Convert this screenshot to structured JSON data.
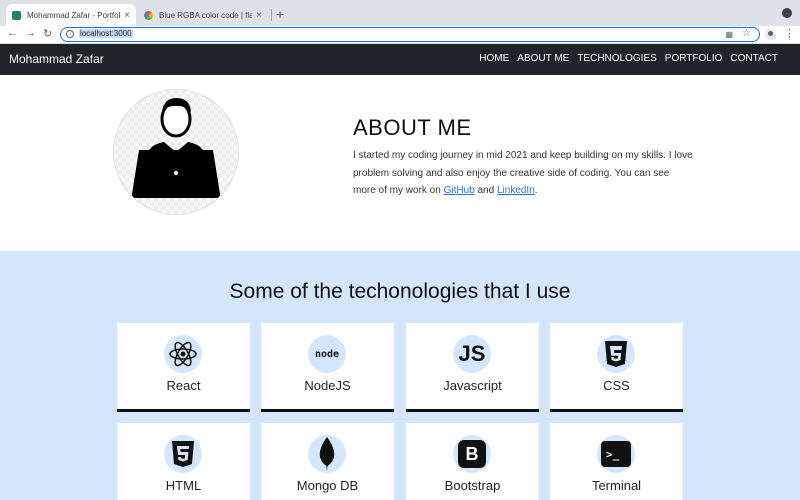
{
  "browser": {
    "tabs": [
      {
        "title": "Mohammad Zafar - Portfolio",
        "favicon_color": "#2e7d6e"
      },
      {
        "title": "Blue RGBA color code | flatuic",
        "favicon_color": "#f4b400"
      }
    ],
    "new_tab": "+",
    "close": "×",
    "address": "localhost:3000",
    "back": "←",
    "forward": "→",
    "reload": "↻",
    "star": "☆",
    "menu": "⋮"
  },
  "site": {
    "brand": "Mohammad Zafar",
    "menu": [
      "HOME",
      "ABOUT ME",
      "TECHNOLOGIES",
      "PORTFOLIO",
      "CONTACT"
    ]
  },
  "about": {
    "title": "ABOUT ME",
    "text_before": "I started my coding journey in mid 2021 and keep building on my skills. I love problem solving and also enjoy the creative side of coding. You can see more of my work on ",
    "link1": "GitHub",
    "middle": " and ",
    "link2": "LinkedIn",
    "end": "."
  },
  "tech": {
    "title": "Some of the techonologies that I use",
    "items": [
      {
        "label": "React",
        "icon": "react-icon"
      },
      {
        "label": "NodeJS",
        "icon": "nodejs-icon"
      },
      {
        "label": "Javascript",
        "icon": "javascript-icon"
      },
      {
        "label": "CSS",
        "icon": "css3-icon"
      },
      {
        "label": "HTML",
        "icon": "html5-icon"
      },
      {
        "label": "Mongo DB",
        "icon": "mongodb-icon"
      },
      {
        "label": "Bootstrap",
        "icon": "bootstrap-icon"
      },
      {
        "label": "Terminal",
        "icon": "terminal-icon"
      }
    ],
    "icon_glyphs": {
      "js": "JS",
      "node": "node",
      "bootstrap": "B",
      "terminal": ">_"
    }
  },
  "colors": {
    "navbar": "#212529",
    "tech_bg": "#d4e6fb",
    "link": "#2a6fdb"
  }
}
